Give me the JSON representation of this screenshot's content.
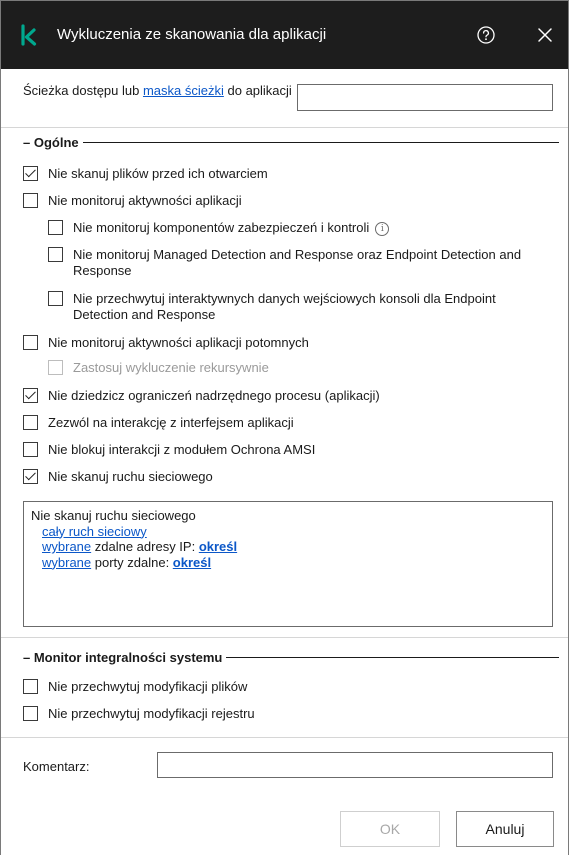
{
  "titlebar": {
    "title": "Wykluczenia ze skanowania dla aplikacji",
    "logo_icon": "kaspersky-k-logo",
    "accent_color": "#00a88e",
    "help_icon": "help-circle-icon",
    "close_icon": "close-icon"
  },
  "path": {
    "label_prefix": "Ścieżka dostępu lub ",
    "label_link": "maska ścieżki",
    "label_suffix": " do aplikacji",
    "value": ""
  },
  "general": {
    "heading": "– Ogólne",
    "items": [
      {
        "label": "Nie skanuj plików przed ich otwarciem",
        "checked": true,
        "disabled": false
      },
      {
        "label": "Nie monitoruj aktywności aplikacji",
        "checked": false,
        "disabled": false
      },
      {
        "label": "Nie monitoruj komponentów zabezpieczeń i kontroli",
        "checked": false,
        "disabled": false
      },
      {
        "label": "Nie monitoruj Managed Detection and Response oraz Endpoint Detection and Response",
        "checked": false,
        "disabled": false
      },
      {
        "label": "Nie przechwytuj interaktywnych danych wejściowych konsoli dla Endpoint Detection and Response",
        "checked": false,
        "disabled": false
      },
      {
        "label": "Nie monitoruj aktywności aplikacji potomnych",
        "checked": false,
        "disabled": false
      },
      {
        "label": "Zastosuj wykluczenie rekursywnie",
        "checked": false,
        "disabled": true
      },
      {
        "label": "Nie dziedzicz ograniczeń nadrzędnego procesu (aplikacji)",
        "checked": true,
        "disabled": false
      },
      {
        "label": "Zezwól na interakcję z interfejsem aplikacji",
        "checked": false,
        "disabled": false
      },
      {
        "label": "Nie blokuj interakcji z modułem Ochrona AMSI",
        "checked": false,
        "disabled": false
      },
      {
        "label": "Nie skanuj ruchu sieciowego",
        "checked": true,
        "disabled": false
      }
    ]
  },
  "network": {
    "title": "Nie skanuj ruchu sieciowego",
    "all_traffic_link": "cały ruch sieciowy",
    "ip_link": "wybrane",
    "ip_text": " zdalne adresy IP: ",
    "ip_action": "określ",
    "ports_link": "wybrane",
    "ports_text": " porty zdalne: ",
    "ports_action": "określ"
  },
  "integrity": {
    "heading": "– Monitor integralności systemu",
    "items": [
      {
        "label": "Nie przechwytuj modyfikacji plików",
        "checked": false
      },
      {
        "label": "Nie przechwytuj modyfikacji rejestru",
        "checked": false
      }
    ]
  },
  "comment": {
    "label": "Komentarz:",
    "value": ""
  },
  "footer": {
    "ok_label": "OK",
    "cancel_label": "Anuluj"
  }
}
